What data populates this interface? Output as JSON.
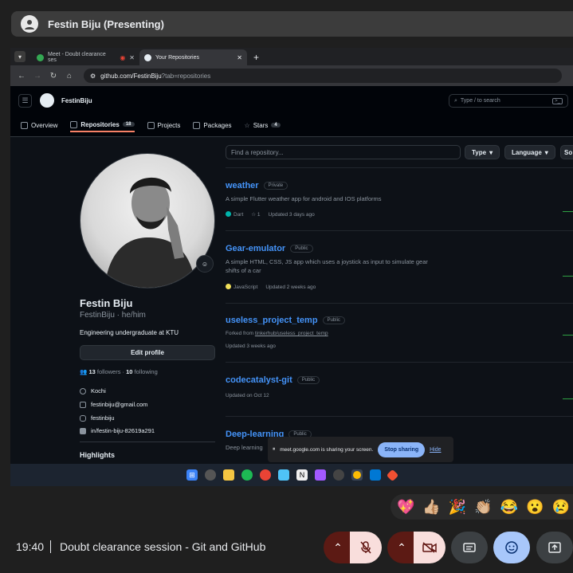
{
  "presenter": {
    "name": "Festin Biju (Presenting)"
  },
  "browser": {
    "tabs": [
      {
        "title": "Meet - Doubt clearance ses",
        "active": false
      },
      {
        "title": "Your Repositories",
        "active": true
      }
    ],
    "url_host": "github.com/FestinBiju",
    "url_path": "?tab=repositories",
    "new_tab_label": "+"
  },
  "github": {
    "username": "FestinBiju",
    "search_placeholder": "Type / to search",
    "search_key": "/",
    "tabs": [
      {
        "label": "Overview",
        "count": ""
      },
      {
        "label": "Repositories",
        "count": "18"
      },
      {
        "label": "Projects",
        "count": ""
      },
      {
        "label": "Packages",
        "count": ""
      },
      {
        "label": "Stars",
        "count": "4"
      }
    ]
  },
  "profile": {
    "name": "Festin Biju",
    "login": "FestinBiju · he/him",
    "bio": "Engineering undergraduate at KTU",
    "edit_label": "Edit profile",
    "followers": "13",
    "followers_label": "followers",
    "following": "10",
    "following_label": "following",
    "location": "Kochi",
    "email": "festinbiju@gmail.com",
    "instagram": "festinbiju",
    "linkedin": "in/festin-biju-82619a291",
    "highlights_label": "Highlights"
  },
  "repo_filters": {
    "find_placeholder": "Find a repository...",
    "type_label": "Type",
    "language_label": "Language",
    "sort_label": "So"
  },
  "repos": [
    {
      "name": "weather",
      "visibility": "Private",
      "description": "A simple Flutter weather app for android and IOS platforms",
      "language": "Dart",
      "language_color": "#00B4AB",
      "stars": "1",
      "updated": "Updated 3 days ago"
    },
    {
      "name": "Gear-emulator",
      "visibility": "Public",
      "description": "A simple HTML, CSS, JS app which uses a joystick as input to simulate gear shifts of a car",
      "language": "JavaScript",
      "language_color": "#f1e05a",
      "updated": "Updated 2 weeks ago"
    },
    {
      "name": "useless_project_temp",
      "visibility": "Public",
      "forked_prefix": "Forked from",
      "forked_from": "tinkerhub/useless_project_temp",
      "updated": "Updated 3 weeks ago"
    },
    {
      "name": "codecatalyst-git",
      "visibility": "Public",
      "updated": "Updated on Oct 12"
    },
    {
      "name": "Deep-learning",
      "visibility": "Public",
      "description": "Deep learning"
    }
  ],
  "share_notice": {
    "pause_icon": "pause-icon",
    "text": "meet.google.com is sharing your screen.",
    "stop_label": "Stop sharing",
    "hide_label": "Hide"
  },
  "taskbar_icons": [
    "windows-icon",
    "chatgpt-icon",
    "files-icon",
    "spotify-icon",
    "chrome-icon",
    "notes-icon",
    "notion-icon",
    "figma-icon",
    "openai-icon",
    "chrome-active-icon",
    "vscode-icon",
    "git-icon"
  ],
  "reactions": [
    "💖",
    "👍🏼",
    "🎉",
    "👏🏼",
    "😂",
    "😮",
    "😢"
  ],
  "meet": {
    "time": "19:40",
    "meeting_title": "Doubt clearance session - Git and GitHub"
  },
  "colors": {
    "accent_link": "#4493f8",
    "meet_red": "#5c1a14",
    "meet_blue": "#a8c7fa"
  }
}
